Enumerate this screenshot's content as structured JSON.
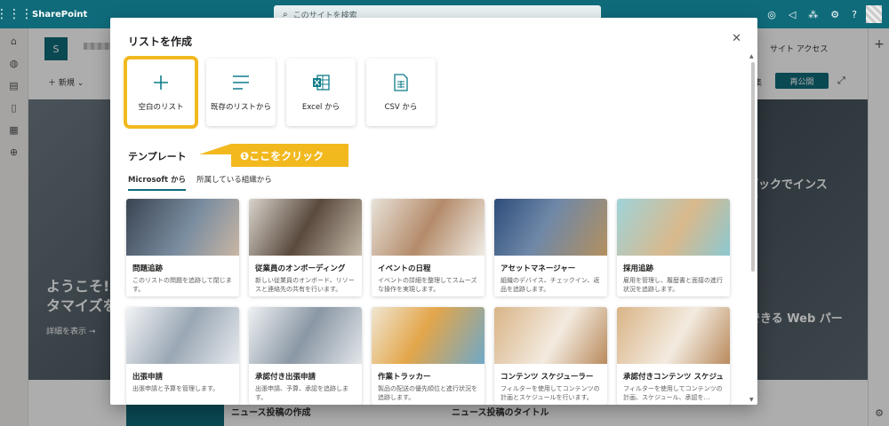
{
  "app": {
    "name": "SharePoint",
    "search_placeholder": "このサイトを検索"
  },
  "background": {
    "site_logo": "S",
    "new_label": "＋ 新規 ⌄",
    "site_access": "サイト アクセス",
    "edit_label": "集",
    "republish": "再公開",
    "hero_left": "ようこそ!\nタマイズを",
    "hero_more": "詳細を表示 →",
    "hero_right": "ブックでインス\nす",
    "hero_right2": "できる Web パー",
    "news1": "ニュース投稿の作成",
    "news2": "ニュース投稿のタイトル"
  },
  "modal": {
    "title": "リストを作成",
    "close": "✕",
    "create_options": [
      {
        "label": "空白のリスト",
        "icon": "plus-icon"
      },
      {
        "label": "既存のリストから",
        "icon": "list-lines-icon"
      },
      {
        "label": "Excel から",
        "icon": "excel-icon"
      },
      {
        "label": "CSV から",
        "icon": "csv-file-icon"
      }
    ],
    "callout": "❶ここをクリック",
    "templates_heading": "テンプレート",
    "tabs": [
      "Microsoft から",
      "所属している組織から"
    ],
    "templates": [
      {
        "title": "問題追跡",
        "desc": "このリストの問題を追跡して閉じます。"
      },
      {
        "title": "従業員のオンボーディング",
        "desc": "新しい従業員のオンボード、リソースと連絡先の共有を行います。"
      },
      {
        "title": "イベントの日程",
        "desc": "イベントの詳細を整理してスムーズな操作を実現します。"
      },
      {
        "title": "アセットマネージャー",
        "desc": "組織のデバイス、チェックイン、返品を追跡します。"
      },
      {
        "title": "採用追跡",
        "desc": "雇用を管理し、履歴書と面接の進行状況を追跡します。"
      },
      {
        "title": "出張申請",
        "desc": "出張申請と予算を管理します。"
      },
      {
        "title": "承認付き出張申請",
        "desc": "出張申請、予算、承認を追跡します。"
      },
      {
        "title": "作業トラッカー",
        "desc": "製品の配送の優先順位と進行状況を追跡します。"
      },
      {
        "title": "コンテンツ スケジューラー",
        "desc": "フィルターを使用してコンテンツの計画とスケジュールを行います。"
      },
      {
        "title": "承認付きコンテンツ スケジュ…",
        "desc": "フィルターを使用してコンテンツの計画、スケジュール、承認を…"
      }
    ]
  },
  "colors": {
    "brand": "#0f6b7a",
    "highlight": "#f2b91f"
  }
}
